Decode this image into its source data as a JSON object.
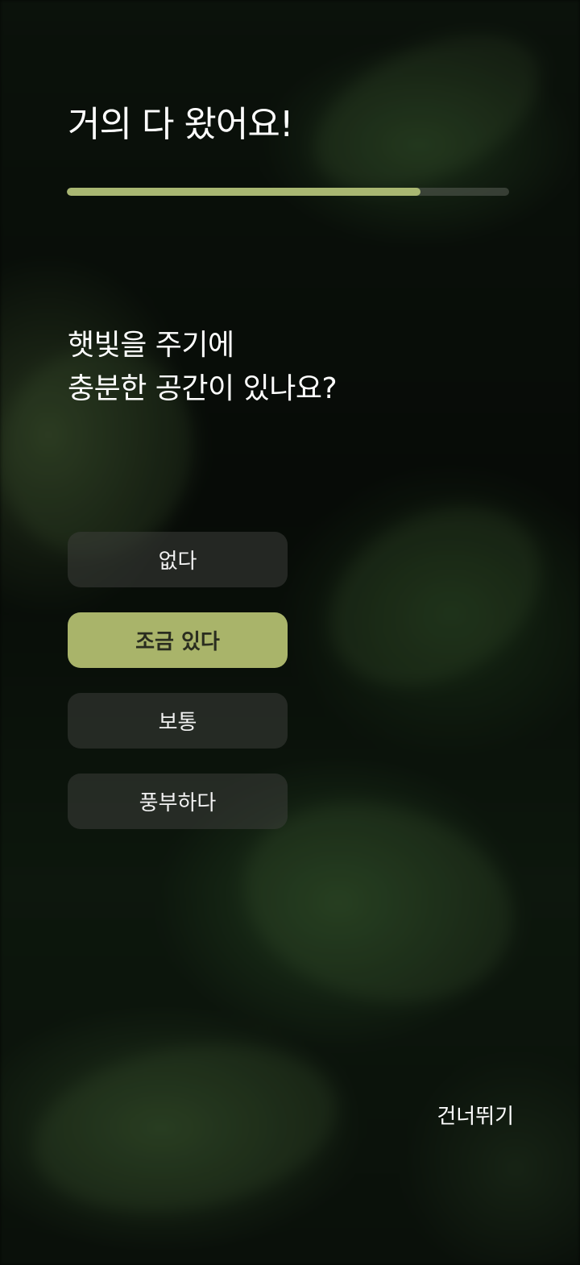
{
  "header": {
    "title": "거의 다 왔어요!"
  },
  "progress": {
    "value": 0.8,
    "fill_color": "#a9b772",
    "track_color": "#4a4e46"
  },
  "question": {
    "line1": "햇빛을 주기에",
    "line2": "충분한 공간이 있나요?"
  },
  "options": [
    {
      "label": "없다",
      "selected": false
    },
    {
      "label": "조금 있다",
      "selected": true
    },
    {
      "label": "보통",
      "selected": false
    },
    {
      "label": "풍부하다",
      "selected": false
    }
  ],
  "footer": {
    "skip_label": "건너뛰기"
  },
  "colors": {
    "accent": "#a9b46a",
    "option_bg": "#3c3e3a",
    "text": "#ffffff"
  },
  "background": {
    "image": "blurred-fern-leaves"
  }
}
